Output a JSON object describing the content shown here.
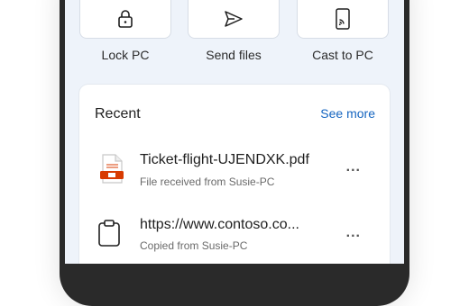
{
  "quick_actions": [
    {
      "label": "Lock PC",
      "icon": "lock-icon"
    },
    {
      "label": "Send files",
      "icon": "send-icon"
    },
    {
      "label": "Cast to PC",
      "icon": "cast-icon"
    }
  ],
  "recent": {
    "title": "Recent",
    "see_more": "See more",
    "items": [
      {
        "title": "Ticket-flight-UJENDXK.pdf",
        "subtitle": "File received from Susie-PC",
        "icon": "pdf-file-icon",
        "more": "..."
      },
      {
        "title": "https://www.contoso.co...",
        "subtitle": "Copied from Susie-PC",
        "icon": "clipboard-icon",
        "more": "..."
      }
    ]
  },
  "colors": {
    "accent": "#1565c0",
    "pdf_red": "#d83b01",
    "screen_bg": "#eef3fa"
  }
}
